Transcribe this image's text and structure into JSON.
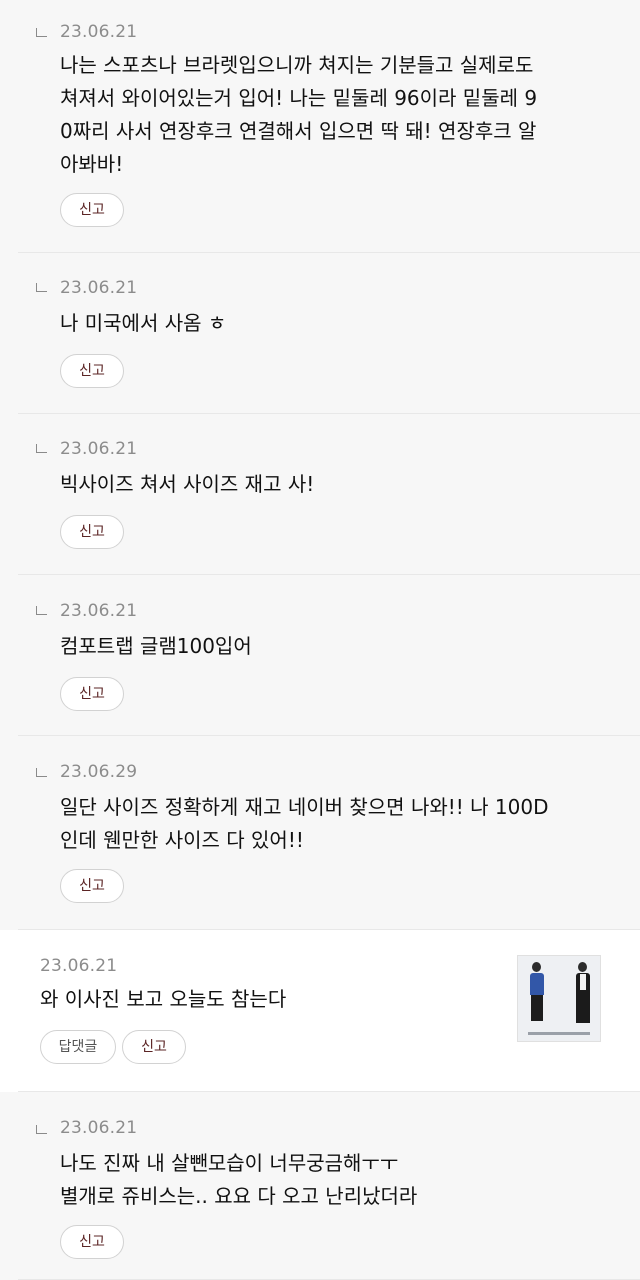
{
  "comments": [
    {
      "date": "23.06.21",
      "text": "나는 스포츠나 브라렛입으니까 쳐지는 기분들고 실제로도\n쳐져서 와이어있는거 입어! 나는 밑둘레 96이라 밑둘레 9\n0짜리 사서 연장후크 연결해서 입으면 딱 돼! 연장후크 알\n아봐바!",
      "report": "신고"
    },
    {
      "date": "23.06.21",
      "text": "나 미국에서 사옴 ㅎ",
      "report": "신고"
    },
    {
      "date": "23.06.21",
      "text": "빅사이즈 쳐서 사이즈 재고 사!",
      "report": "신고"
    },
    {
      "date": "23.06.21",
      "text": "컴포트랩 글램100입어",
      "report": "신고"
    },
    {
      "date": "23.06.29",
      "text": "일단 사이즈 정확하게 재고 네이버 찾으면 나와!! 나 100D\n인데 웬만한 사이즈 다 있어!!",
      "report": "신고"
    },
    {
      "date": "23.06.21",
      "text": "와 이사진 보고 오늘도 참는다",
      "reply": "답댓글",
      "report": "신고"
    },
    {
      "date": "23.06.21",
      "text": "나도 진짜 내 살뺀모습이 너무궁금해ㅜㅜ\n별개로 쥬비스는.. 요요 다 오고 난리났더라",
      "report": "신고"
    }
  ]
}
